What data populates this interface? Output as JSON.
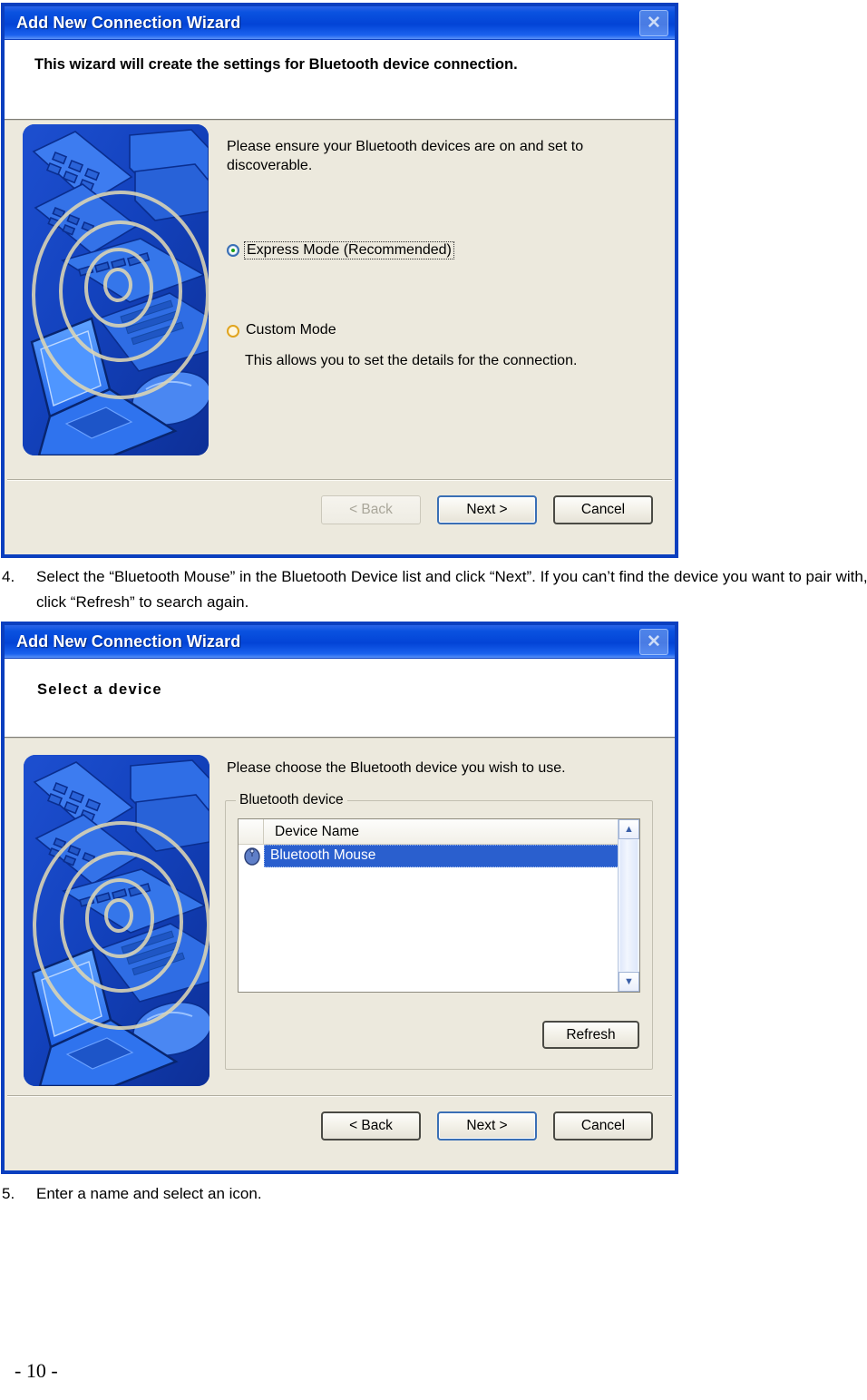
{
  "page": {
    "page_number": "- 10 -"
  },
  "colors": {
    "titlebar_blue": "#0344d6",
    "dialog_border": "#0b3fbf",
    "dialog_face": "#ece9dd",
    "selection_blue": "#2a5fce",
    "radio_selected_dot": "#19a019",
    "radio_unselected_ring": "#e0a41f"
  },
  "dialog1": {
    "title": "Add New Connection Wizard",
    "close_icon": "close-icon",
    "close_label": "✕",
    "header_text": "This wizard will create the settings for Bluetooth device connection.",
    "illustration_name": "bluetooth-devices-illustration",
    "instruction_text": "Please ensure your Bluetooth devices are on and set to discoverable.",
    "options": [
      {
        "label": "Express Mode (Recommended)",
        "accel": "E",
        "selected": true,
        "description": ""
      },
      {
        "label": "Custom Mode",
        "accel": "C",
        "selected": false,
        "description": "This allows you to set the details for the connection."
      }
    ],
    "buttons": [
      {
        "label": "< Back",
        "accel": "B",
        "state": "disabled",
        "style": "plain"
      },
      {
        "label": "Next >",
        "accel": "N",
        "state": "enabled",
        "style": "default"
      },
      {
        "label": "Cancel",
        "accel": "",
        "state": "enabled",
        "style": "strong"
      }
    ]
  },
  "step4": {
    "number": "4.",
    "text": "Select the “Bluetooth Mouse” in the Bluetooth Device list and click “Next”. If you can’t find the device you want to pair with, click “Refresh” to search again."
  },
  "dialog2": {
    "title": "Add New Connection Wizard",
    "close_icon": "close-icon",
    "close_label": "✕",
    "header_text": "Select a device",
    "illustration_name": "bluetooth-devices-illustration",
    "instruction_text": "Please choose the Bluetooth device you wish to use.",
    "groupbox": {
      "title": "Bluetooth device",
      "list_column_header": "Device Name",
      "rows": [
        {
          "icon": "bluetooth-mouse-icon",
          "name": "Bluetooth Mouse",
          "selected": true
        }
      ],
      "scrollbar": {
        "up_arrow": "▲",
        "down_arrow": "▼"
      },
      "refresh_button": {
        "label": "Refresh",
        "accel": "R"
      }
    },
    "buttons": [
      {
        "label": "< Back",
        "accel": "B",
        "state": "enabled",
        "style": "plain"
      },
      {
        "label": "Next >",
        "accel": "N",
        "state": "enabled",
        "style": "default"
      },
      {
        "label": "Cancel",
        "accel": "",
        "state": "enabled",
        "style": "strong"
      }
    ]
  },
  "step5": {
    "number": "5.",
    "text": "Enter a name and select an icon."
  }
}
